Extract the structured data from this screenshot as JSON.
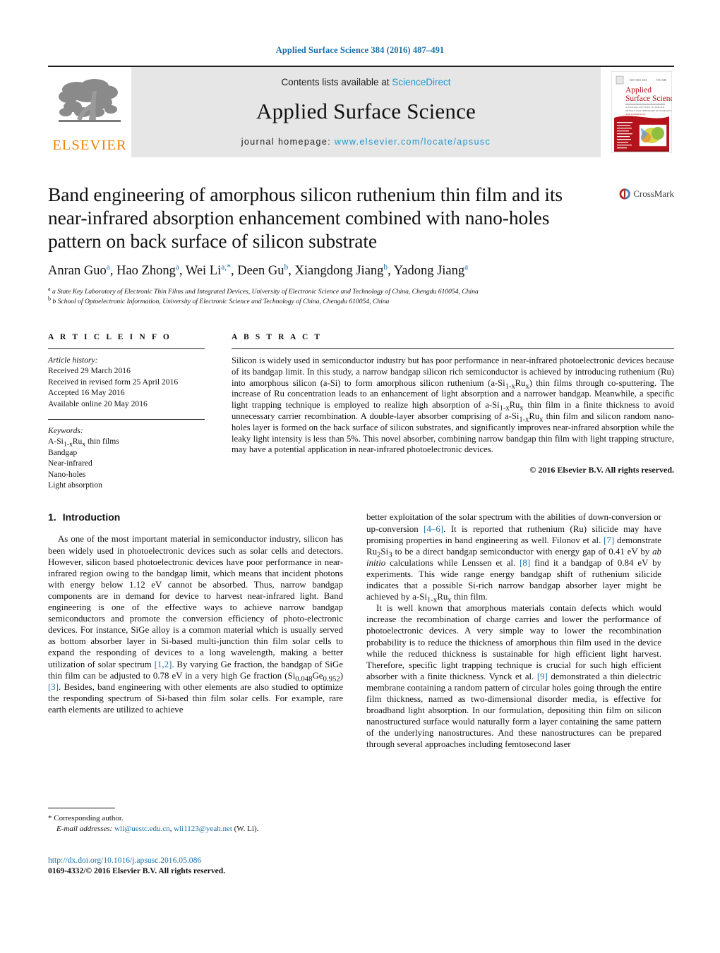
{
  "running_head": "Applied Surface Science 384 (2016) 487–491",
  "masthead": {
    "contents_prefix": "Contents lists available at ",
    "sciencedirect": "ScienceDirect",
    "journal_title": "Applied Surface Science",
    "homepage_prefix": "journal homepage: ",
    "homepage_url": "www.elsevier.com/locate/apsusc",
    "publisher_wordmark": "ELSEVIER",
    "publisher_color": "#ef8200",
    "link_color": "#2196cf",
    "cover_title_line1": "Applied",
    "cover_title_line2": "Surface Science"
  },
  "crossmark": {
    "label": "CrossMark"
  },
  "article": {
    "title": "Band engineering of amorphous silicon ruthenium thin film and its near-infrared absorption enhancement combined with nano-holes pattern on back surface of silicon substrate",
    "authors_html": "Anran Guo<sup>a</sup>, Hao Zhong<sup>a</sup>, Wei Li<sup>a,*</sup>, Deen Gu<sup>b</sup>, Xiangdong Jiang<sup>b</sup>, Yadong Jiang<sup>a</sup>",
    "affiliations": [
      "a State Key Laboratory of Electronic Thin Films and Integrated Devices, University of Electronic Science and Technology of China, Chengdu 610054, China",
      "b School of Optoelectronic Information, University of Electronic Science and Technology of China, Chengdu 610054, China"
    ]
  },
  "article_info": {
    "heading": "A R T I C L E   I N F O",
    "history_label": "Article history:",
    "history": [
      "Received 29 March 2016",
      "Received in revised form 25 April 2016",
      "Accepted 16 May 2016",
      "Available online 20 May 2016"
    ],
    "keywords_label": "Keywords:",
    "keywords_html": [
      "A-Si<sub>1-x</sub>Ru<sub>x</sub> thin films",
      "Bandgap",
      "Near-infrared",
      "Nano-holes",
      "Light absorption"
    ]
  },
  "abstract": {
    "heading": "A B S T R A C T",
    "text_html": "Silicon is widely used in semiconductor industry but has poor performance in near-infrared photoelectronic devices because of its bandgap limit. In this study, a narrow bandgap silicon rich semiconductor is achieved by introducing ruthenium (Ru) into amorphous silicon (a-Si) to form amorphous silicon ruthenium (a-Si<sub>1-x</sub>Ru<sub>x</sub>) thin films through co-sputtering. The increase of Ru concentration leads to an enhancement of light absorption and a narrower bandgap. Meanwhile, a specific light trapping technique is employed to realize high absorption of a-Si<sub>1-x</sub>Ru<sub>x</sub> thin film in a finite thickness to avoid unnecessary carrier recombination. A double-layer absorber comprising of a-Si<sub>1-x</sub>Ru<sub>x</sub> thin film and silicon random nano-holes layer is formed on the back surface of silicon substrates, and significantly improves near-infrared absorption while the leaky light intensity is less than 5%. This novel absorber, combining narrow bandgap thin film with light trapping structure, may have a potential application in near-infrared photoelectronic devices.",
    "copyright": "© 2016 Elsevier B.V. All rights reserved."
  },
  "body": {
    "section_number": "1.",
    "section_title": "Introduction",
    "left_paragraphs_html": [
      "As one of the most important material in semiconductor industry, silicon has been widely used in photoelectronic devices such as solar cells and detectors. However, silicon based photoelectronic devices have poor performance in near-infrared region owing to the bandgap limit, which means that incident photons with energy below 1.12 eV cannot be absorbed. Thus, narrow bandgap components are in demand for device to harvest near-infrared light. Band engineering is one of the effective ways to achieve narrow bandgap semiconductors and promote the conversion efficiency of photo-electronic devices. For instance, SiGe alloy is a common material which is usually served as bottom absorber layer in Si-based multi-junction thin film solar cells to expand the responding of devices to a long wavelength, making a better utilization of solar spectrum <span class=\"ref\">[1,2]</span>. By varying Ge fraction, the bandgap of SiGe thin film can be adjusted to 0.78 eV in a very high Ge fraction (Si<sub>0.048</sub>Ge<sub>0.952</sub>) <span class=\"ref\">[3]</span>. Besides, band engineering with other elements are also studied to optimize the responding spectrum of Si-based thin film solar cells. For example, rare earth elements are utilized to achieve"
    ],
    "right_paragraphs_html": [
      "better exploitation of the solar spectrum with the abilities of down-conversion or up-conversion <span class=\"ref\">[4–6]</span>. It is reported that ruthenium (Ru) silicide may have promising properties in band engineering as well. Filonov et al. <span class=\"ref\">[7]</span> demonstrate Ru<sub>2</sub>Si<sub>3</sub> to be a direct bandgap semiconductor with energy gap of 0.41 eV by <i>ab initio</i> calculations while Lenssen et al. <span class=\"ref\">[8]</span> find it a bandgap of 0.84 eV by experiments. This wide range energy bandgap shift of ruthenium silicide indicates that a possible Si-rich narrow bandgap absorber layer might be achieved by a-Si<sub>1-x</sub>Ru<sub>x</sub> thin film.",
      "It is well known that amorphous materials contain defects which would increase the recombination of charge carries and lower the performance of photoelectronic devices. A very simple way to lower the recombination probability is to reduce the thickness of amorphous thin film used in the device while the reduced thickness is sustainable for high efficient light harvest. Therefore, specific light trapping technique is crucial for such high efficient absorber with a finite thickness. Vynck et al. <span class=\"ref\">[9]</span> demonstrated a thin dielectric membrane containing a random pattern of circular holes going through the entire film thickness, named as two-dimensional disorder media, is effective for broadband light absorption. In our formulation, depositing thin film on silicon nanostructured surface would naturally form a layer containing the same pattern of the underlying nanostructures. And these nanostructures can be prepared through several approaches including femtosecond laser"
    ]
  },
  "footnote": {
    "corresponding_marker": "*",
    "corresponding_text": "Corresponding author.",
    "email_label": "E-mail addresses:",
    "email1": "wli@uestc.edu.cn",
    "email2": "wli1123@yeah.net",
    "email_suffix": "(W. Li)."
  },
  "doi": {
    "url": "http://dx.doi.org/10.1016/j.apsusc.2016.05.086",
    "issn_line": "0169-4332/© 2016 Elsevier B.V. All rights reserved."
  }
}
